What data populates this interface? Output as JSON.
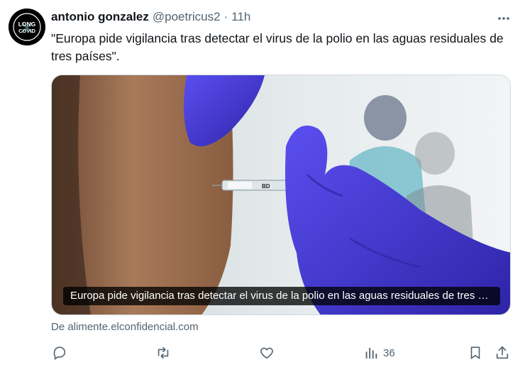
{
  "tweet": {
    "author_name": "antonio gonzalez",
    "handle": "@poetricus2",
    "separator": "·",
    "time": "11h",
    "avatar_lines": [
      "LONG",
      "COVID"
    ],
    "avatar_ring_text": "LONG COVID AWARENESS",
    "text": "\"Europa pide vigilancia tras detectar el virus de la polio en las aguas residuales de tres países\".",
    "card": {
      "caption": "Europa pide vigilancia tras detectar el virus de la polio en las aguas residuales de tres países",
      "syringe_brand": "BD"
    },
    "source": "De alimente.elconfidencial.com",
    "actions": {
      "views_count": "36"
    }
  },
  "colors": {
    "text_primary": "#0f1419",
    "text_secondary": "#536471",
    "glove": "#4a3fd8",
    "border": "#cfd9de"
  },
  "icons": [
    "more-icon",
    "reply-icon",
    "retweet-icon",
    "like-icon",
    "views-icon",
    "bookmark-icon",
    "share-icon"
  ]
}
